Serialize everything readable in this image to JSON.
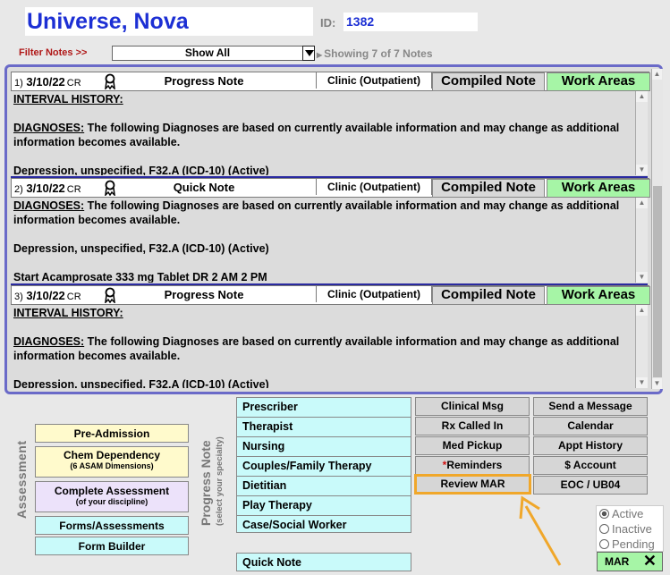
{
  "patient": {
    "name": "Universe, Nova",
    "id_label": "ID:",
    "id_value": "1382"
  },
  "filter": {
    "label": "Filter Notes >>",
    "selected": "Show All",
    "showing": "Showing 7 of 7 Notes"
  },
  "note_buttons": {
    "compiled": "Compiled Note",
    "work_areas": "Work Areas"
  },
  "notes": [
    {
      "num": "1)",
      "date": "3/10/22",
      "cr": "CR",
      "type": "Progress Note",
      "location": "Clinic (Outpatient)",
      "line1": "INTERVAL HISTORY:",
      "dx_label": "DIAGNOSES:",
      "dx_text": " The following Diagnoses are based on currently available information and may change as additional information becomes available.",
      "cut_line": "Depression, unspecified, F32.A (ICD-10) (Active)"
    },
    {
      "num": "2)",
      "date": "3/10/22",
      "cr": "CR",
      "type": "Quick Note",
      "location": "Clinic (Outpatient)",
      "dx_label": "DIAGNOSES:",
      "dx_text": " The following Diagnoses are based on currently available information and may change as additional information becomes available.",
      "line2": "Depression, unspecified, F32.A (ICD-10) (Active)",
      "cut_line": "Start Acamprosate 333 mg Tablet DR 2 AM 2 PM"
    },
    {
      "num": "3)",
      "date": "3/10/22",
      "cr": "CR",
      "type": "Progress Note",
      "location": "Clinic (Outpatient)",
      "line1": "INTERVAL HISTORY:",
      "dx_label": "DIAGNOSES:",
      "dx_text": " The following Diagnoses are based on currently available information and may change as additional information becomes available.",
      "cut_line": "Depression, unspecified, F32.A (ICD-10) (Active)"
    }
  ],
  "assessment": {
    "label": "Assessment",
    "pre_admission": "Pre-Admission",
    "chem_dep": "Chem Dependency",
    "chem_dep_sub": "(6 ASAM Dimensions)",
    "complete": "Complete Assessment",
    "complete_sub": "(of your discipline)",
    "forms": "Forms/Assessments",
    "builder": "Form Builder"
  },
  "progress_note": {
    "label": "Progress Note",
    "sublabel": "(select your specialty)",
    "items": [
      "Prescriber",
      "Therapist",
      "Nursing",
      "Couples/Family Therapy",
      "Dietitian",
      "Play Therapy",
      "Case/Social Worker"
    ],
    "quick_note": "Quick Note"
  },
  "tools": {
    "clinical_msg": "Clinical Msg",
    "send_message": "Send a Message",
    "rx_called": "Rx Called In",
    "calendar": "Calendar",
    "med_pickup": "Med Pickup",
    "appt_history": "Appt History",
    "reminders_star": "*",
    "reminders": "Reminders",
    "account": "$ Account",
    "review_mar": "Review MAR",
    "eoc": "EOC / UB04"
  },
  "status": {
    "active": "Active",
    "inactive": "Inactive",
    "pending": "Pending",
    "selected": "Active"
  },
  "mar": {
    "label": "MAR",
    "icon": "close-icon"
  },
  "colors": {
    "accent_blue": "#1c2fd4",
    "highlight_orange": "#f0a72a",
    "work_green": "#a6f5a6"
  }
}
